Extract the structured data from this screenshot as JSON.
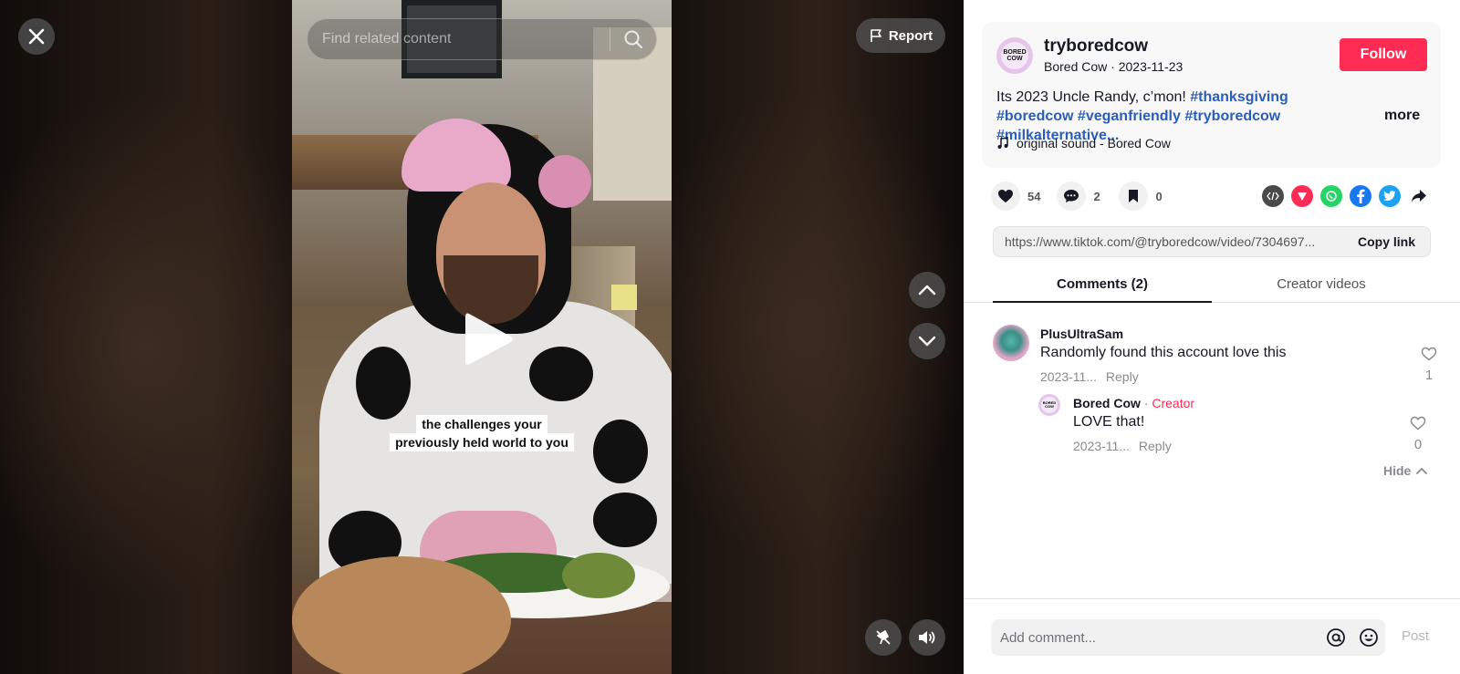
{
  "overlay": {
    "search": {
      "placeholder": "Find related content"
    },
    "report_label": "Report",
    "caption_lines": [
      "the challenges your",
      "previously held world to you"
    ]
  },
  "author": {
    "username": "tryboredcow",
    "avatar_text": "BORED COW",
    "display_name": "Bored Cow",
    "date": "2023-11-23",
    "follow_label": "Follow"
  },
  "description": {
    "text": "Its 2023 Uncle Randy, c’mon! ",
    "hashtags": [
      "#thanksgiving",
      "#boredcow",
      "#veganfriendly",
      "#tryboredcow",
      "#milkalternative..."
    ],
    "more_label": "more",
    "sound": "original sound - Bored Cow"
  },
  "actions": {
    "likes": "54",
    "comments": "2",
    "saves": "0"
  },
  "share": {
    "colors": {
      "embed": "#4a4a4a",
      "send": "#fe2c55",
      "whatsapp": "#25d366",
      "facebook": "#1877f2",
      "twitter": "#1da1f2"
    },
    "link": "https://www.tiktok.com/@tryboredcow/video/7304697...",
    "copy_label": "Copy link"
  },
  "tabs": {
    "comments": "Comments (2)",
    "creator_videos": "Creator videos"
  },
  "comments": [
    {
      "username": "PlusUltraSam",
      "text": "Randomly found this account love this",
      "date": "2023-11...",
      "reply_label": "Reply",
      "likes": "1",
      "replies": [
        {
          "username": "Bored Cow",
          "creator_label": "Creator",
          "text": "LOVE that!",
          "date": "2023-11...",
          "reply_label": "Reply",
          "likes": "0"
        }
      ]
    }
  ],
  "hide_label": "Hide",
  "comment_bar": {
    "placeholder": "Add comment...",
    "post_label": "Post"
  },
  "colors": {
    "accent": "#fe2c55",
    "hashtag": "#2b5db9"
  }
}
